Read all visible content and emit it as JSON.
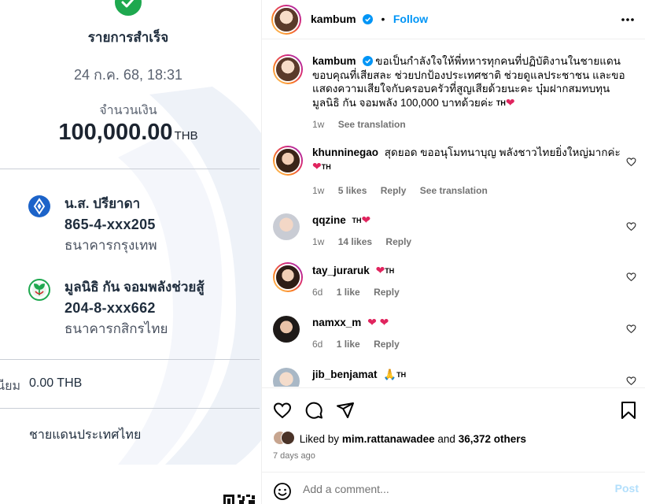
{
  "slip": {
    "title": "รายการสำเร็จ",
    "datetime": "24 ก.ค. 68, 18:31",
    "amount_label": "จำนวนเงิน",
    "amount": "100,000.00",
    "currency": "THB",
    "sender": {
      "name": "น.ส. ปรียาดา",
      "account": "865-4-xxx205",
      "bank": "ธนาคารกรุงเทพ",
      "logo_color": "#1c63c9",
      "logo_icon": "bangkok-bank-logo"
    },
    "receiver": {
      "name": "มูลนิธิ กัน จอมพลังช่วยสู้",
      "account": "204-8-xxx662",
      "bank": "ธนาคารกสิกรไทย",
      "logo_color": "#1ea84f",
      "logo_icon": "kasikorn-bank-logo"
    },
    "fee_label": "ธรรมเนียม",
    "fee_value": "0.00 THB",
    "memo": "ชายแดนประเทศไทย",
    "success_color": "#1ea84f"
  },
  "post": {
    "header": {
      "username": "kambum",
      "separator": "•",
      "follow_label": "Follow"
    },
    "caption": {
      "username": "kambum",
      "text": "ขอเป็นกำลังใจให้พี่ทหารทุกคนที่ปฏิบัติงานในชายแดน ขอบคุณที่เสียสละ ช่วยปกป้องประเทศชาติ ช่วยดูแลประชาชน และขอแสดงความเสียใจกับครอบครัวที่สูญเสียด้วยนะคะ บุ๋มฝากสมทบทุน มูลนิธิ กัน จอมพลัง 100,000 บาทด้วยค่ะ",
      "th": "TH",
      "time": "1w",
      "see_translation": "See translation"
    },
    "comments": [
      {
        "username": "khunninegao",
        "text": "สุดยอด ขออนุโมทนาบุญ พลังชาวไทยยิ่งใหญ่มากค่ะ",
        "time": "1w",
        "likes": "5 likes",
        "reply": "Reply",
        "see_translation": "See translation",
        "th": "TH"
      },
      {
        "username": "qqzine",
        "text": "",
        "time": "1w",
        "likes": "14 likes",
        "reply": "Reply",
        "th": "TH"
      },
      {
        "username": "tay_juraruk",
        "text": "",
        "time": "6d",
        "likes": "1 like",
        "reply": "Reply",
        "th": "TH"
      },
      {
        "username": "namxx_m",
        "text": "",
        "time": "6d",
        "likes": "1 like",
        "reply": "Reply"
      },
      {
        "username": "jib_benjamat",
        "text": "🙏",
        "th": "TH"
      }
    ],
    "likes": {
      "prefix": "Liked by",
      "user": "mim.rattanawadee",
      "middle": "and",
      "count": "36,372 others"
    },
    "time_ago": "7 days ago",
    "add_comment": {
      "placeholder": "Add a comment...",
      "post_label": "Post"
    },
    "colors": {
      "accent": "#0095f6",
      "heart": "#e0245e",
      "muted": "#737373"
    }
  }
}
